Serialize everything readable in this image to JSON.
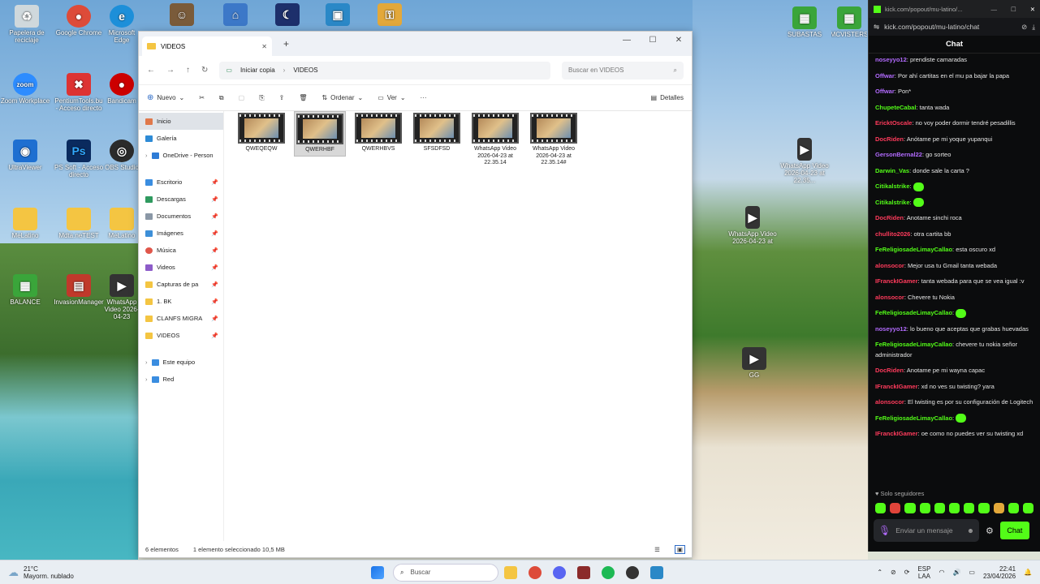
{
  "desktop": {
    "icons_left": [
      {
        "label": "Papelera de reciclaje",
        "color": "#cfd8dc"
      },
      {
        "label": "Google Chrome",
        "color": "#dd4b39"
      },
      {
        "label": "Microsoft Edge",
        "color": "#1d8fd9"
      },
      {
        "label": "",
        "color": "#7a5b3a"
      },
      {
        "label": "",
        "color": "#3c78c8"
      },
      {
        "label": "",
        "color": "#1d2f6b"
      },
      {
        "label": "",
        "color": "#2a88c7"
      },
      {
        "label": "",
        "color": "#e3a83a"
      }
    ],
    "col1": [
      "Zoom Workplace",
      "UltraViewer",
      "MeLatino",
      "BALANCE"
    ],
    "col2": [
      "PentiumTools.bu - Acceso directo",
      "PS Soft - Acceso directo",
      "Mdta.neTEST",
      "InvasionManager"
    ],
    "col3": [
      "Bandicam",
      "OBS Studio",
      "MeLatino",
      "WhatsApp Video 2026-04-23"
    ],
    "right_icons": [
      "SUBASTAS",
      "MCVISTERS"
    ],
    "floating": [
      "WhatsApp Video 2026-04-23 at 22.35...",
      "WhatsApp Video 2026-04-23 at",
      "GG"
    ]
  },
  "explorer": {
    "tab_title": "VIDEOS",
    "new_tab": "+",
    "breadcrumb": [
      "Iniciar copia",
      "VIDEOS"
    ],
    "search_placeholder": "Buscar en VIDEOS",
    "toolbar": {
      "new": "Nuevo",
      "sort": "Ordenar",
      "view": "Ver",
      "more": "···",
      "details": "Detalles"
    },
    "nav": {
      "home": "Inicio",
      "gallery": "Galería",
      "onedrive": "OneDrive - Person",
      "pinned": [
        "Escritorio",
        "Descargas",
        "Documentos",
        "Imágenes",
        "Música",
        "Videos",
        "Capturas de pa",
        "1. BK",
        "CLANFS MIGRA",
        "VIDEOS"
      ],
      "this_pc": "Este equipo",
      "network": "Red"
    },
    "files": [
      {
        "name": "QWEQEQW"
      },
      {
        "name": "QWERHBF"
      },
      {
        "name": "QWERHBVS"
      },
      {
        "name": "SFSDFSD"
      },
      {
        "name": "WhatsApp Video 2026-04-23 at 22.35.14"
      },
      {
        "name": "WhatsApp Video 2026-04-23 at 22.35.14#"
      }
    ],
    "status": {
      "count": "6 elementos",
      "selected": "1 elemento seleccionado  10,5 MB"
    }
  },
  "chat": {
    "window_url_title": "kick.com/popout/mu-latino/...",
    "url": "kick.com/popout/mu-latino/chat",
    "header": "Chat",
    "messages": [
      {
        "user": "noseyyo12",
        "color": "#b36bff",
        "text": "prendiste camaradas"
      },
      {
        "user": "Offwar",
        "color": "#b36bff",
        "text": "Por ahí cartitas en el mu pa bajar la papa"
      },
      {
        "user": "Offwar",
        "color": "#b36bff",
        "text": "Pon*"
      },
      {
        "user": "ChupeteCabal",
        "color": "#53fc18",
        "text": "tanta wada"
      },
      {
        "user": "EricktOscale",
        "color": "#ff3b5c",
        "text": "no voy poder dormir tendré pesadillis"
      },
      {
        "user": "DocRiden",
        "color": "#ff3b5c",
        "text": "Anótame pe mi yoque yupanqui"
      },
      {
        "user": "GersonBernal22",
        "color": "#b36bff",
        "text": "go sorteo"
      },
      {
        "user": "Darwin_Vas",
        "color": "#53fc18",
        "text": "donde sale la carta ?"
      },
      {
        "user": "Citikalstrike",
        "color": "#53fc18",
        "text": "",
        "emote": true
      },
      {
        "user": "Citikalstrike",
        "color": "#53fc18",
        "text": "",
        "emote": true
      },
      {
        "user": "DocRiden",
        "color": "#ff3b5c",
        "text": "Anotame sinchi roca"
      },
      {
        "user": "chullito2026",
        "color": "#ff3b5c",
        "text": "otra cartita bb"
      },
      {
        "user": "FeReligiosadeLimayCallao",
        "color": "#53fc18",
        "text": "esta oscuro xd"
      },
      {
        "user": "alonsocor",
        "color": "#ff3b5c",
        "text": "Mejor usa tu Gmail tanta webada"
      },
      {
        "user": "IFranckIGamer",
        "color": "#ff3b5c",
        "text": "tanta webada para que se vea igual :v"
      },
      {
        "user": "alonsocor",
        "color": "#ff3b5c",
        "text": "Chevere tu Nokia"
      },
      {
        "user": "FeReligiosadeLimayCallao",
        "color": "#53fc18",
        "text": "",
        "emote": true
      },
      {
        "user": "noseyyo12",
        "color": "#b36bff",
        "text": "lo bueno que aceptas que grabas huevadas"
      },
      {
        "user": "FeReligiosadeLimayCallao",
        "color": "#53fc18",
        "text": "chevere tu nokia señor administrador"
      },
      {
        "user": "DocRiden",
        "color": "#ff3b5c",
        "text": "Anotame pe mi wayna capac"
      },
      {
        "user": "IFranckIGamer",
        "color": "#ff3b5c",
        "text": "xd no ves su twisting? yara"
      },
      {
        "user": "alonsocor",
        "color": "#ff3b5c",
        "text": "El twisting es por su configuración de Logitech"
      },
      {
        "user": "FeReligiosadeLimayCallao",
        "color": "#53fc18",
        "text": "",
        "emote": true
      },
      {
        "user": "IFranckIGamer",
        "color": "#ff3b5c",
        "text": "oe como no puedes ver su twisting xd"
      }
    ],
    "followers_only": "Solo seguidores",
    "input_placeholder": "Enviar un mensaje",
    "send_button": "Chat"
  },
  "taskbar": {
    "weather_temp": "21°C",
    "weather_desc": "Mayorm. nublado",
    "search": "Buscar",
    "lang1": "ESP",
    "lang2": "LAA",
    "time": "22:41",
    "date": "23/04/2026"
  }
}
